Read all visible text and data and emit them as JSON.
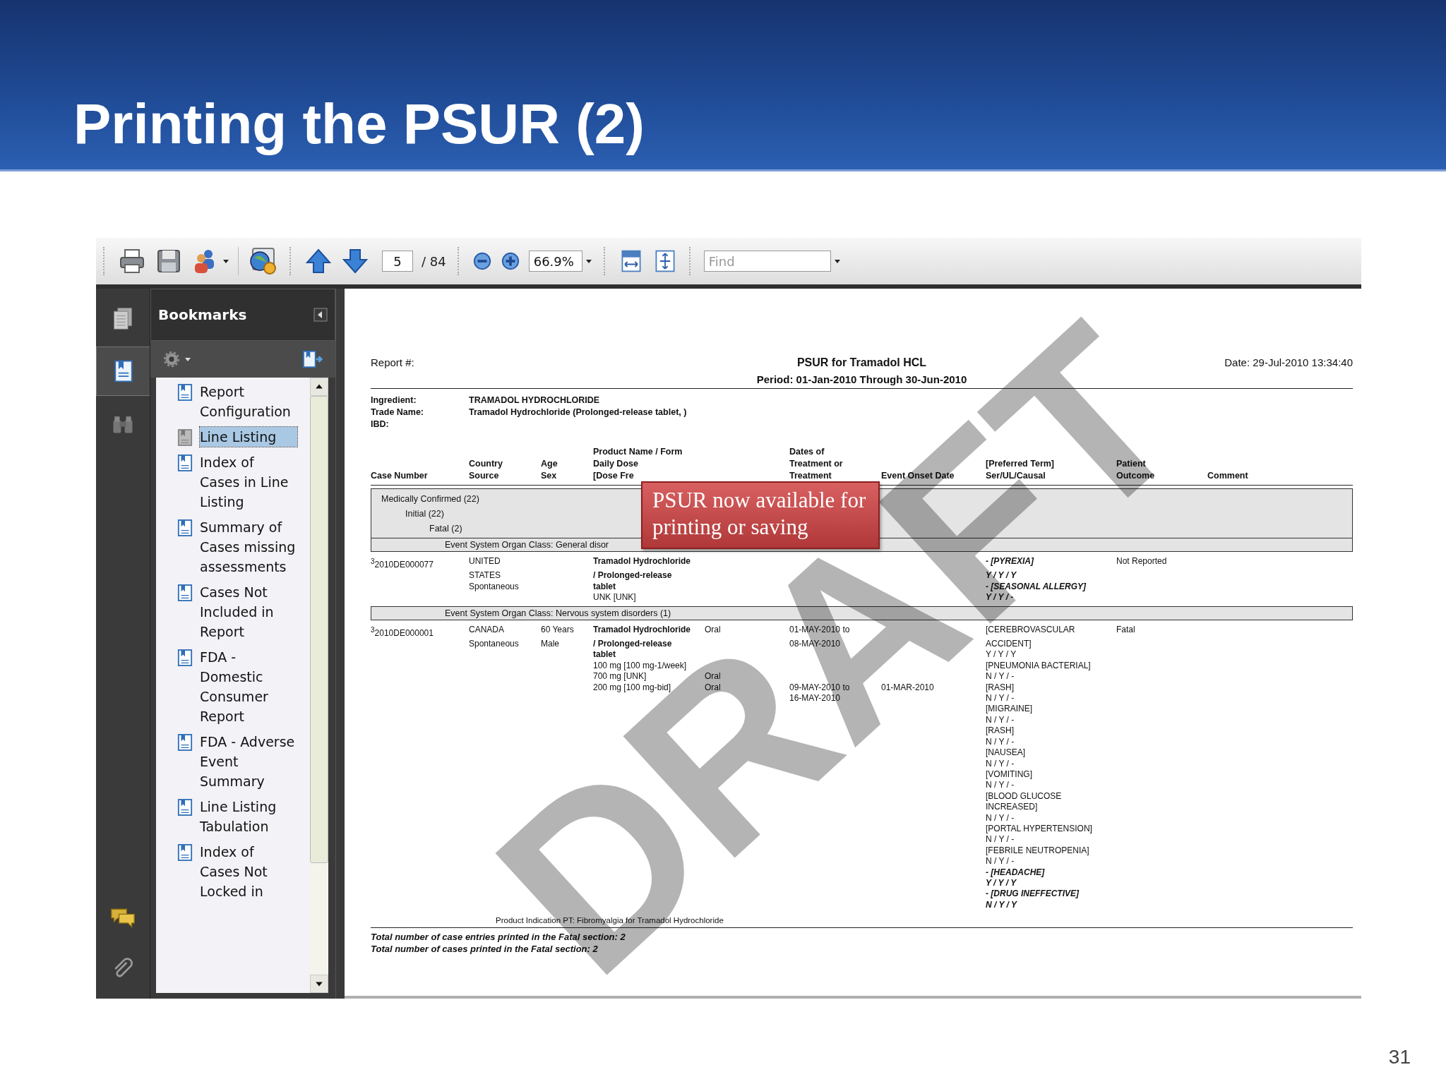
{
  "slide": {
    "title": "Printing the PSUR (2)",
    "number": "31"
  },
  "toolbar": {
    "page": "5",
    "page_count": "/ 84",
    "zoom": "66.9%",
    "find_placeholder": "Find"
  },
  "nav_rail": [
    {
      "kind": "pages",
      "selected": false
    },
    {
      "kind": "bookmarks",
      "selected": true
    },
    {
      "kind": "search",
      "selected": false
    },
    {
      "kind": "comments",
      "selected": false
    },
    {
      "kind": "attachments",
      "selected": false
    }
  ],
  "bookmarks": {
    "title": "Bookmarks",
    "items": [
      {
        "label": "Report Configuration",
        "selected": false
      },
      {
        "label": "Line Listing",
        "selected": true
      },
      {
        "label": "Index of Cases in Line Listing",
        "selected": false
      },
      {
        "label": "Summary of Cases missing assessments",
        "selected": false
      },
      {
        "label": "Cases Not Included in Report",
        "selected": false
      },
      {
        "label": "FDA - Domestic Consumer Report",
        "selected": false
      },
      {
        "label": "FDA - Adverse Event Summary",
        "selected": false
      },
      {
        "label": "Line Listing Tabulation",
        "selected": false
      },
      {
        "label": "Index of Cases Not Locked in",
        "selected": false
      }
    ]
  },
  "document": {
    "report_label": "Report #:",
    "title": "PSUR for Tramadol HCL",
    "date": "Date: 29-Jul-2010 13:34:40",
    "period": "Period: 01-Jan-2010 Through 30-Jun-2010",
    "info": [
      {
        "label": "Ingredient:",
        "value": "TRAMADOL HYDROCHLORIDE"
      },
      {
        "label": "Trade Name:",
        "value": "Tramadol Hydrochloride (Prolonged-release tablet,  )"
      },
      {
        "label": "IBD:"
      }
    ],
    "columns": [
      {
        "lines": [
          "Case Number"
        ]
      },
      {
        "lines": [
          "Country",
          "Source"
        ]
      },
      {
        "lines": [
          "Age",
          "Sex"
        ]
      },
      {
        "lines": [
          "Product Name / Form",
          "Daily Dose",
          "[Dose Fre"
        ]
      },
      {
        "lines": [
          "Dates of",
          "Treatment or",
          "Treatment"
        ]
      },
      {
        "lines": [
          "Event Onset Date"
        ]
      },
      {
        "lines": [
          "[Preferred Term]",
          "Ser/UL/Causal"
        ]
      },
      {
        "lines": [
          "Patient",
          "Outcome"
        ]
      },
      {
        "lines": [
          "Comment"
        ]
      }
    ],
    "groups": [
      {
        "label": "Medically Confirmed (22)",
        "children": [
          {
            "label": "Initial (22)",
            "children": [
              {
                "label": "Fatal (2)"
              }
            ]
          }
        ]
      }
    ],
    "sections": [
      {
        "title": "Event System Organ Class: General disor",
        "cases": [
          {
            "lines": [
              {
                "case": "$^{3}$2010DE000077",
                "country": "UNITED",
                "product": "Tramadol Hydrochloride",
                "product_bold": true,
                "term": "- [PYREXIA]",
                "term_italic": true,
                "outcome": "Not Reported"
              },
              {
                "country": "STATES",
                "product": "/ Prolonged-release",
                "product_bold": true,
                "term": "Y / Y / Y",
                "term_italic": true
              },
              {
                "country": "Spontaneous",
                "product": "tablet",
                "product_bold": true,
                "term": "- [SEASONAL ALLERGY]",
                "term_italic": true
              },
              {
                "product": "UNK [UNK]",
                "term": "Y / Y / -",
                "term_italic": true
              }
            ]
          }
        ]
      },
      {
        "title": "Event System Organ Class: Nervous system disorders (1)",
        "cases": [
          {
            "lines": [
              {
                "case": "$^{3}$2010DE000001",
                "country": "CANADA",
                "age": "60 Years",
                "product": "Tramadol Hydrochloride",
                "product_bold": true,
                "route": "Oral",
                "dates": "01-MAY-2010 to",
                "term": "[CEREBROVASCULAR",
                "outcome": "Fatal"
              },
              {
                "country": "Spontaneous",
                "age": "Male",
                "product": "/ Prolonged-release",
                "product_bold": true,
                "dates": "08-MAY-2010",
                "term": "ACCIDENT]"
              },
              {
                "product": "tablet",
                "product_bold": true,
                "term": "Y / Y / Y"
              },
              {
                "product": "100 mg [100 mg-1/week]",
                "term": "[PNEUMONIA BACTERIAL]"
              },
              {
                "product": "700 mg [UNK]",
                "route": "Oral",
                "term": "N / Y / -"
              },
              {
                "product": "200 mg [100 mg-bid]",
                "route": "Oral",
                "dates": "09-MAY-2010 to",
                "onset": "01-MAR-2010",
                "term": "[RASH]"
              },
              {
                "dates": "16-MAY-2010",
                "term": "N / Y / -"
              },
              {
                "term": "[MIGRAINE]"
              },
              {
                "term": "N / Y / -"
              },
              {
                "term": "[RASH]"
              },
              {
                "term": "N / Y / -"
              },
              {
                "term": "[NAUSEA]"
              },
              {
                "term": "N / Y / -"
              },
              {
                "term": "[VOMITING]"
              },
              {
                "term": "N / Y / -"
              },
              {
                "term": "[BLOOD GLUCOSE"
              },
              {
                "term": "INCREASED]"
              },
              {
                "term": "N / Y / -"
              },
              {
                "term": "[PORTAL HYPERTENSION]"
              },
              {
                "term": "N / Y / -"
              },
              {
                "term": "[FEBRILE NEUTROPENIA]"
              },
              {
                "term": "N / Y / -"
              },
              {
                "term": "- [HEADACHE]",
                "term_italic": true
              },
              {
                "term": "Y / Y / Y",
                "term_italic": true
              },
              {
                "term": "- [DRUG INEFFECTIVE]",
                "term_italic": true
              },
              {
                "term": "N / Y / Y",
                "term_italic": true
              }
            ]
          }
        ]
      }
    ],
    "indication": "Product Indication PT:  Fibromyalgia for Tramadol Hydrochloride",
    "totals": [
      "Total number of case entries printed in the Fatal section: 2",
      "Total number of cases printed in the Fatal section: 2"
    ],
    "watermark": "DRAFT"
  },
  "callout": "PSUR now available for printing or saving"
}
